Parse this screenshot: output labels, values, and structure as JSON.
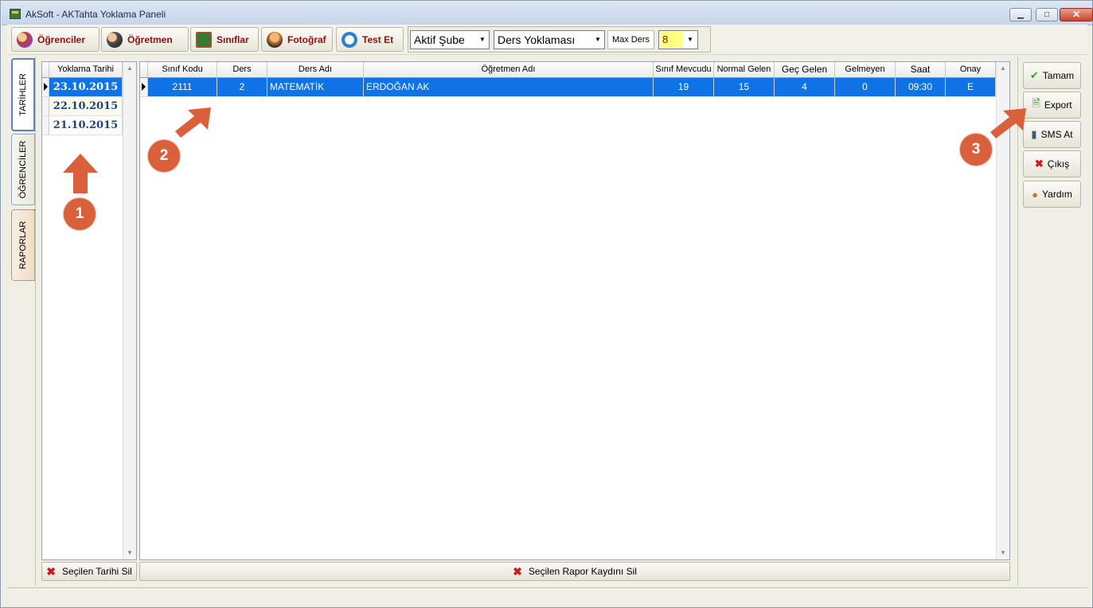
{
  "window": {
    "title": "AkSoft - AKTahta Yoklama Paneli",
    "controls": {
      "minimize": "▁",
      "maximize": "□",
      "close": "✕"
    }
  },
  "toolbar": {
    "buttons": [
      {
        "label": "Öğrenciler",
        "icon": "students-icon"
      },
      {
        "label": "Öğretmen",
        "icon": "teachers-icon"
      },
      {
        "label": "Sınıflar",
        "icon": "classroom-icon"
      },
      {
        "label": "Fotoğraf",
        "icon": "photo-icon"
      },
      {
        "label": "Test Et",
        "icon": "clock-icon"
      }
    ],
    "branch_select": "Aktif Şube",
    "type_select": "Ders Yoklaması",
    "max_ders_label": "Max Ders",
    "max_ders_value": "8"
  },
  "side_tabs": [
    "TARİHLER",
    "ÖĞRENCİLER",
    "RAPORLAR"
  ],
  "dates_grid": {
    "header": "Yoklama Tarihi",
    "rows": [
      "23.10.2015",
      "22.10.2015",
      "21.10.2015"
    ],
    "selected_index": 0
  },
  "report_grid": {
    "headers": [
      "Sınıf Kodu",
      "Ders",
      "Ders Adı",
      "Öğretmen Adı",
      "Sınıf Mevcudu",
      "Normal Gelen",
      "Geç Gelen",
      "Gelmeyen",
      "Saat",
      "Onay"
    ],
    "rows": [
      {
        "sinif_kodu": "2111",
        "ders": "2",
        "ders_adi": "MATEMATİK",
        "ogretmen_adi": "ERDOĞAN AK",
        "sinif_mevcudu": "19",
        "normal_gelen": "15",
        "gec_gelen": "4",
        "gelmeyen": "0",
        "saat": "09:30",
        "onay": "E"
      }
    ]
  },
  "bottom_buttons": {
    "delete_date": "Seçilen Tarihi Sil",
    "delete_report": "Seçilen Rapor Kaydını Sil"
  },
  "side_buttons": [
    {
      "label": "Tamam",
      "icon": "check-icon"
    },
    {
      "label": "Export",
      "icon": "export-icon"
    },
    {
      "label": "SMS At",
      "icon": "phone-icon"
    },
    {
      "label": "Çıkış",
      "icon": "close-icon"
    },
    {
      "label": "Yardım",
      "icon": "help-user-icon"
    }
  ],
  "annotations": [
    "1",
    "2",
    "3"
  ],
  "colors": {
    "accent": "#0f73e6",
    "annotation": "#d9603b",
    "brand_text": "#8a1010"
  }
}
